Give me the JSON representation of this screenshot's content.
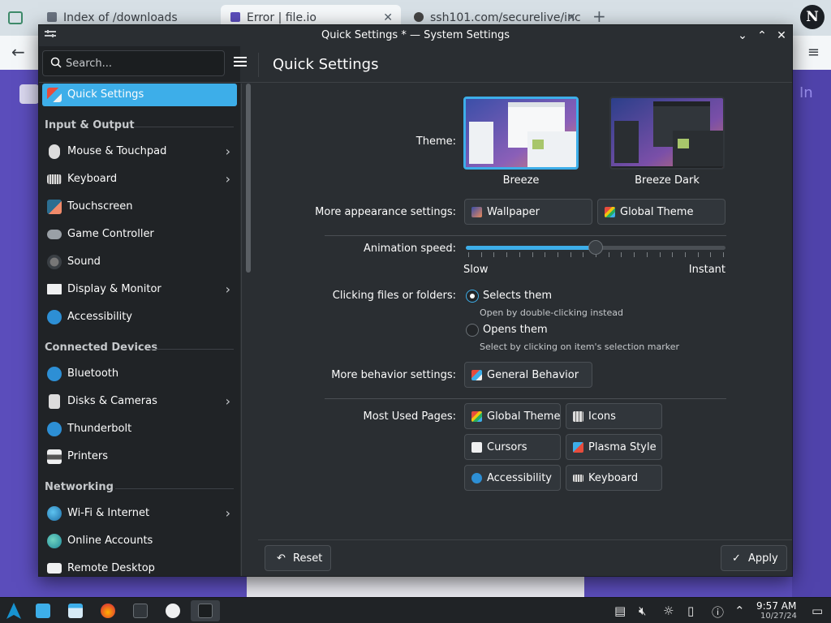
{
  "browser": {
    "tabs": [
      {
        "label": "Index of /downloads"
      },
      {
        "label": "Error | file.io"
      },
      {
        "label": "ssh101.com/securelive/inc"
      }
    ],
    "new_tab": "+",
    "page_text_right": "In",
    "avatar_letter": "N"
  },
  "window": {
    "title": "Quick Settings * — System Settings",
    "search_placeholder": "Search...",
    "page_title": "Quick Settings"
  },
  "sidebar": {
    "selected": "Quick Settings",
    "top": {
      "label": "Quick Settings",
      "icon": "quick-settings-icon"
    },
    "categories": [
      {
        "name": "Input & Output",
        "items": [
          {
            "label": "Mouse & Touchpad",
            "icon": "mouse-icon",
            "has_arrow": true
          },
          {
            "label": "Keyboard",
            "icon": "keyboard-icon",
            "has_arrow": true
          },
          {
            "label": "Touchscreen",
            "icon": "touchscreen-icon",
            "has_arrow": false
          },
          {
            "label": "Game Controller",
            "icon": "gamepad-icon",
            "has_arrow": false
          },
          {
            "label": "Sound",
            "icon": "sound-icon",
            "has_arrow": false
          },
          {
            "label": "Display & Monitor",
            "icon": "monitor-icon",
            "has_arrow": true
          },
          {
            "label": "Accessibility",
            "icon": "accessibility-icon",
            "has_arrow": false
          }
        ]
      },
      {
        "name": "Connected Devices",
        "items": [
          {
            "label": "Bluetooth",
            "icon": "bluetooth-icon",
            "has_arrow": false
          },
          {
            "label": "Disks & Cameras",
            "icon": "disk-icon",
            "has_arrow": true
          },
          {
            "label": "Thunderbolt",
            "icon": "thunderbolt-icon",
            "has_arrow": false
          },
          {
            "label": "Printers",
            "icon": "printer-icon",
            "has_arrow": false
          }
        ]
      },
      {
        "name": "Networking",
        "items": [
          {
            "label": "Wi-Fi & Internet",
            "icon": "globe-icon",
            "has_arrow": true
          },
          {
            "label": "Online Accounts",
            "icon": "online-accounts-icon",
            "has_arrow": false
          },
          {
            "label": "Remote Desktop",
            "icon": "remote-desktop-icon",
            "has_arrow": false
          }
        ]
      }
    ]
  },
  "content": {
    "theme_label": "Theme:",
    "themes": [
      {
        "name": "Breeze",
        "selected": true
      },
      {
        "name": "Breeze Dark",
        "selected": false
      }
    ],
    "appearance_label": "More appearance settings:",
    "appearance_buttons": [
      "Wallpaper",
      "Global Theme"
    ],
    "animation_label": "Animation speed:",
    "animation_slow": "Slow",
    "animation_instant": "Instant",
    "animation_value": 0.5,
    "clicking_label": "Clicking files or folders:",
    "radio_options": [
      {
        "label": "Selects them",
        "hint": "Open by double-clicking instead",
        "checked": true
      },
      {
        "label": "Opens them",
        "hint": "Select by clicking on item's selection marker",
        "checked": false
      }
    ],
    "behavior_label": "More behavior settings:",
    "behavior_button": "General Behavior",
    "most_used_label": "Most Used Pages:",
    "most_used": [
      "Global Theme",
      "Icons",
      "Cursors",
      "Plasma Style",
      "Accessibility",
      "Keyboard"
    ]
  },
  "footer": {
    "reset": "Reset",
    "apply": "Apply"
  },
  "taskbar": {
    "time": "9:57 AM",
    "date": "10/27/24"
  },
  "colors": {
    "accent": "#3daee9",
    "window_bg": "#2a2e32",
    "sidebar_bg": "#202326"
  }
}
